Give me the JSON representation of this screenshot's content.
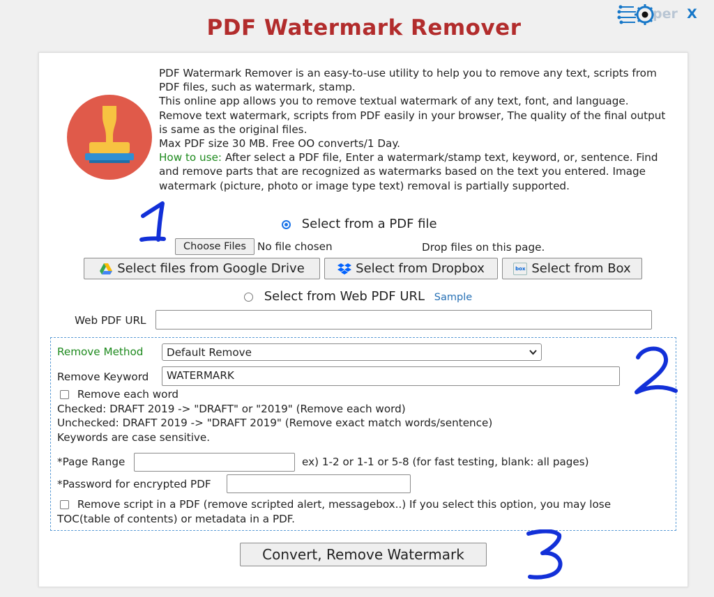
{
  "title": "PDF Watermark Remover",
  "brand": {
    "text_prefix": "per",
    "text_suffix": "X"
  },
  "description": {
    "line1": "PDF Watermark Remover is an easy-to-use utility to help you to remove any text, scripts from PDF files, such as watermark, stamp.",
    "line2": "This online app allows you to remove textual watermark of any text, font, and language. Remove text watermark, scripts from PDF easily in your browser, The quality of the final output is same as the original files.",
    "line3": "Max PDF size 30 MB. Free OO converts/1 Day.",
    "howto_label": "How to use:",
    "howto_text": " After select a PDF file, Enter a watermark/stamp text, keyword, or, sentence. Find and remove parts that are recognized as watermarks based on the text you entered. Image watermark (picture, photo or image type text) removal is partially supported."
  },
  "source": {
    "pdf_file_label": "Select from a PDF file",
    "choose_files_label": "Choose Files",
    "no_file_text": "No file chosen",
    "drop_text": "Drop files on this page.",
    "google_drive_label": "Select files from Google Drive",
    "dropbox_label": "Select from Dropbox",
    "box_label": "Select from Box",
    "box_icon_text": "box",
    "web_url_option_label": "Select from Web PDF URL",
    "sample_link": "Sample",
    "web_url_field_label": "Web PDF URL",
    "web_url_value": ""
  },
  "options": {
    "remove_method_label": "Remove Method",
    "remove_method_value": "Default Remove",
    "remove_keyword_label": "Remove Keyword",
    "remove_keyword_value": "WATERMARK",
    "remove_each_word_label": "Remove each word",
    "checked_note": "Checked: DRAFT 2019 -> \"DRAFT\" or \"2019\" (Remove each word)",
    "unchecked_note": "Unchecked: DRAFT 2019 -> \"DRAFT 2019\" (Remove exact match words/sentence)",
    "case_note": "Keywords are case sensitive.",
    "page_range_label": "*Page Range",
    "page_range_value": "",
    "page_range_hint": "ex) 1-2 or 1-1 or 5-8 (for fast testing, blank: all pages)",
    "password_label": "*Password for encrypted PDF",
    "password_value": "",
    "remove_script_line1": "Remove script in a PDF (remove scripted alert, messagebox..) If you select this option, you may lose",
    "remove_script_line2": "TOC(table of contents) or metadata in a PDF."
  },
  "convert_button_label": "Convert, Remove Watermark",
  "annotations": [
    "1",
    "2",
    "3"
  ],
  "colors": {
    "title": "#b22c2c",
    "green_label": "#1e8a1e",
    "annotation_ink": "#1230d8",
    "dashed_border": "#5a9bd5",
    "icon_circle": "#e05a4a"
  }
}
